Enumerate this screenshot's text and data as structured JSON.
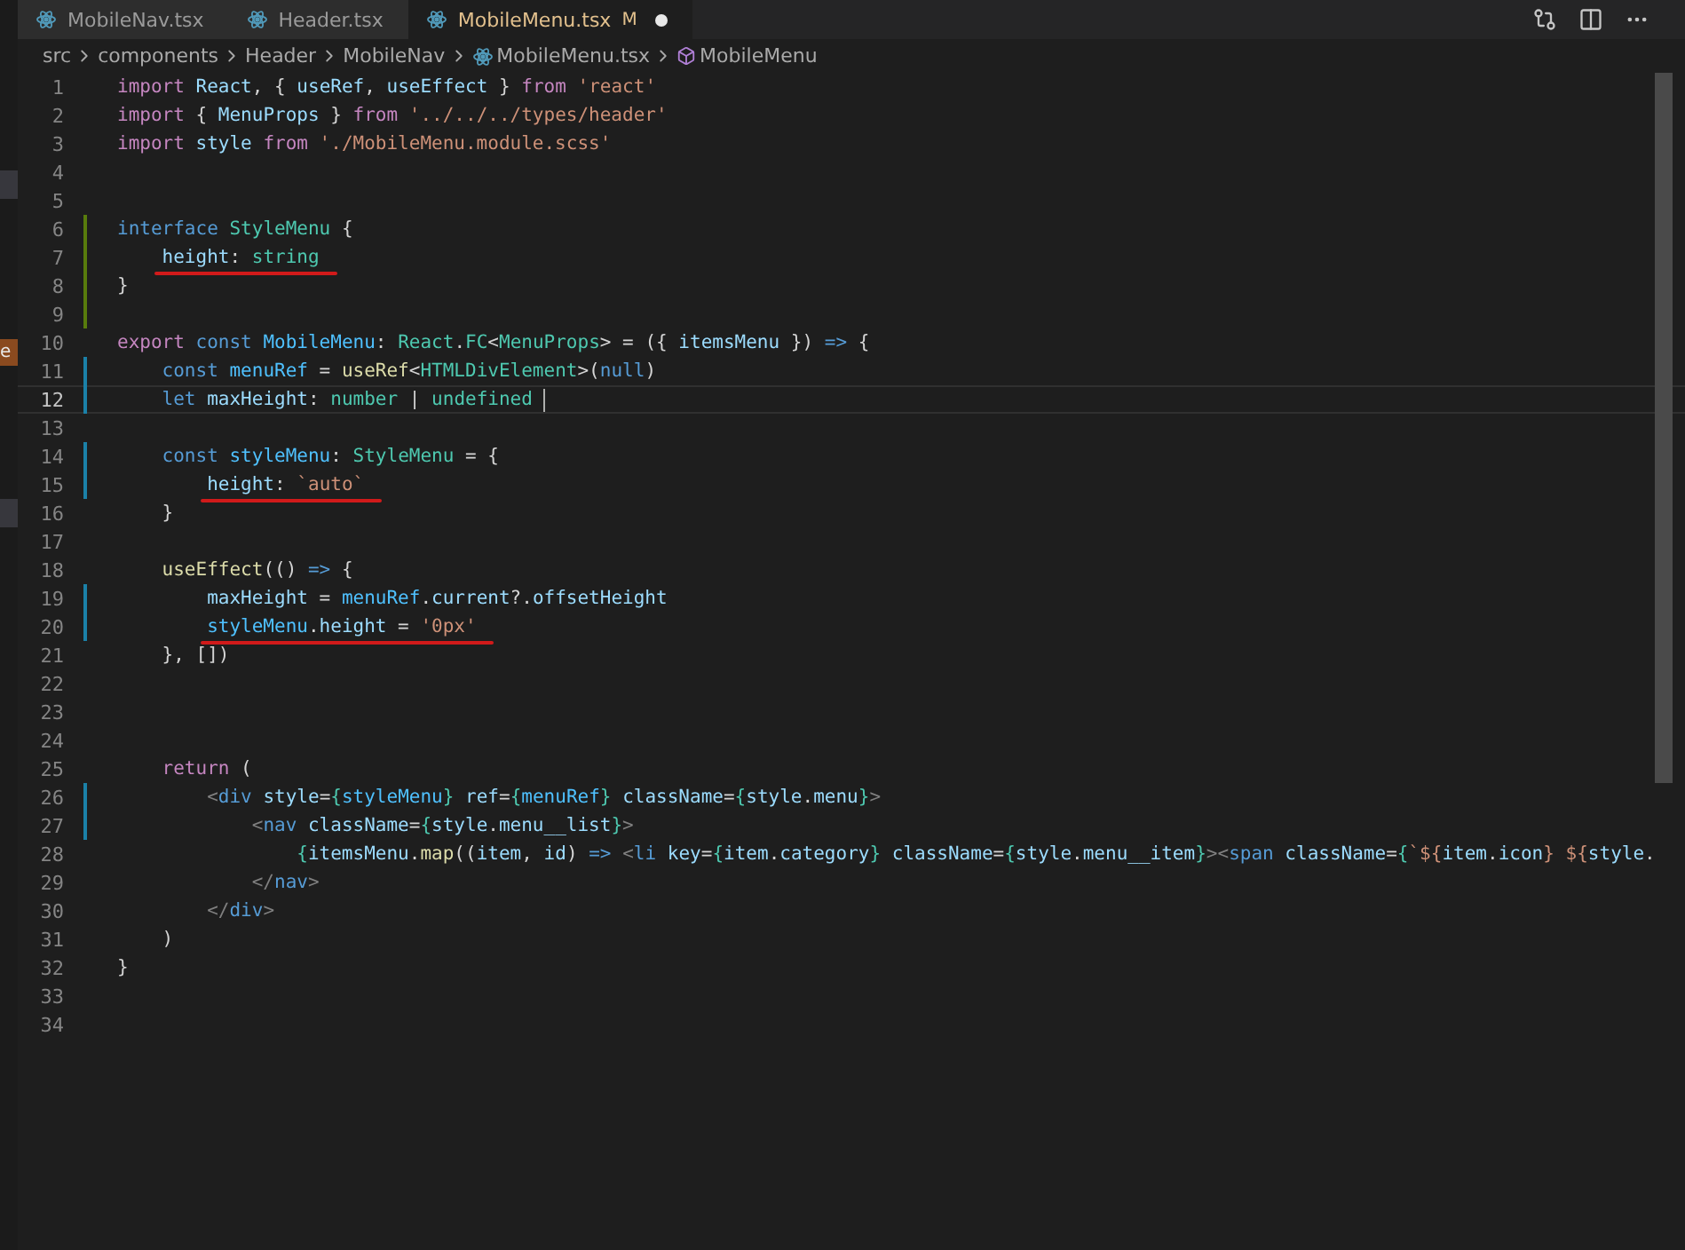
{
  "side_badge": "e",
  "tabs": [
    {
      "label": "MobileNav.tsx",
      "selected": false,
      "dirty": false
    },
    {
      "label": "Header.tsx",
      "selected": false,
      "dirty": false
    },
    {
      "label": "MobileMenu.tsx",
      "selected": true,
      "badge": "M",
      "dirty": true
    }
  ],
  "breadcrumb": [
    {
      "label": "src",
      "kind": "folder"
    },
    {
      "label": "components",
      "kind": "folder"
    },
    {
      "label": "Header",
      "kind": "folder"
    },
    {
      "label": "MobileNav",
      "kind": "folder"
    },
    {
      "label": "MobileMenu.tsx",
      "kind": "file"
    },
    {
      "label": "MobileMenu",
      "kind": "symbol"
    }
  ],
  "lines": [
    {
      "number": "1",
      "current": false,
      "underlined": false,
      "tokens": [
        {
          "kind": "kw",
          "text": "import"
        },
        {
          "kind": "v",
          "text": " React"
        },
        {
          "kind": "p",
          "text": ", { "
        },
        {
          "kind": "v",
          "text": "useRef"
        },
        {
          "kind": "p",
          "text": ", "
        },
        {
          "kind": "v",
          "text": "useEffect"
        },
        {
          "kind": "p",
          "text": " } "
        },
        {
          "kind": "kw",
          "text": "from"
        },
        {
          "kind": "s",
          "text": " 'react'"
        }
      ]
    },
    {
      "number": "2",
      "current": false,
      "underlined": false,
      "tokens": [
        {
          "kind": "kw",
          "text": "import"
        },
        {
          "kind": "p",
          "text": " { "
        },
        {
          "kind": "v",
          "text": "MenuProps"
        },
        {
          "kind": "p",
          "text": " } "
        },
        {
          "kind": "kw",
          "text": "from"
        },
        {
          "kind": "s",
          "text": " '../../../types/header'"
        }
      ]
    },
    {
      "number": "3",
      "current": false,
      "underlined": false,
      "tokens": [
        {
          "kind": "kw",
          "text": "import"
        },
        {
          "kind": "v",
          "text": " style"
        },
        {
          "kind": "kw",
          "text": " from"
        },
        {
          "kind": "s",
          "text": " './MobileMenu.module.scss'"
        }
      ]
    },
    {
      "number": "4",
      "current": false,
      "underlined": false
    },
    {
      "number": "5",
      "current": false,
      "underlined": false
    },
    {
      "number": "6",
      "current": false,
      "kind": "added",
      "underlined": false,
      "tokens": [
        {
          "kind": "st",
          "text": "interface"
        },
        {
          "kind": "t",
          "text": " StyleMenu"
        },
        {
          "kind": "p",
          "text": " {"
        }
      ]
    },
    {
      "number": "7",
      "current": false,
      "kind": "added",
      "underlined": true,
      "tokens": [
        {
          "kind": "v",
          "text": "    height"
        },
        {
          "kind": "p",
          "text": ": "
        },
        {
          "kind": "t",
          "text": "string"
        }
      ]
    },
    {
      "number": "8",
      "current": false,
      "kind": "added",
      "underlined": false,
      "tokens": [
        {
          "kind": "p",
          "text": "}"
        }
      ]
    },
    {
      "number": "9",
      "current": false,
      "kind": "added",
      "underlined": false
    },
    {
      "number": "10",
      "current": false,
      "underlined": false,
      "tokens": [
        {
          "kind": "kw",
          "text": "export"
        },
        {
          "kind": "st",
          "text": " const"
        },
        {
          "kind": "c",
          "text": " MobileMenu"
        },
        {
          "kind": "p",
          "text": ": "
        },
        {
          "kind": "t",
          "text": "React"
        },
        {
          "kind": "p",
          "text": "."
        },
        {
          "kind": "t",
          "text": "FC"
        },
        {
          "kind": "p",
          "text": "<"
        },
        {
          "kind": "t",
          "text": "MenuProps"
        },
        {
          "kind": "p",
          "text": "> = ({ "
        },
        {
          "kind": "v",
          "text": "itemsMenu"
        },
        {
          "kind": "p",
          "text": " }) "
        },
        {
          "kind": "st",
          "text": "=>"
        },
        {
          "kind": "p",
          "text": " {"
        }
      ]
    },
    {
      "number": "11",
      "current": false,
      "kind": "modified",
      "underlined": false,
      "tokens": [
        {
          "kind": "st",
          "text": "    const"
        },
        {
          "kind": "c",
          "text": " menuRef"
        },
        {
          "kind": "p",
          "text": " = "
        },
        {
          "kind": "f",
          "text": "useRef"
        },
        {
          "kind": "p",
          "text": "<"
        },
        {
          "kind": "t",
          "text": "HTMLDivElement"
        },
        {
          "kind": "p",
          "text": ">("
        },
        {
          "kind": "st",
          "text": "null"
        },
        {
          "kind": "p",
          "text": ")"
        }
      ]
    },
    {
      "number": "12",
      "current": true,
      "kind": "modified",
      "underlined": false,
      "tokens": [
        {
          "kind": "st",
          "text": "    let"
        },
        {
          "kind": "v",
          "text": " maxHeight"
        },
        {
          "kind": "p",
          "text": ": "
        },
        {
          "kind": "t",
          "text": "number"
        },
        {
          "kind": "p",
          "text": " | "
        },
        {
          "kind": "t",
          "text": "undefined "
        }
      ]
    },
    {
      "number": "13",
      "current": false,
      "underlined": false
    },
    {
      "number": "14",
      "current": false,
      "kind": "modified",
      "underlined": false,
      "tokens": [
        {
          "kind": "st",
          "text": "    const"
        },
        {
          "kind": "c",
          "text": " styleMenu"
        },
        {
          "kind": "p",
          "text": ": "
        },
        {
          "kind": "t",
          "text": "StyleMenu"
        },
        {
          "kind": "p",
          "text": " = {"
        }
      ]
    },
    {
      "number": "15",
      "current": false,
      "kind": "modified",
      "underlined": true,
      "tokens": [
        {
          "kind": "v",
          "text": "        height"
        },
        {
          "kind": "p",
          "text": ": "
        },
        {
          "kind": "s",
          "text": "`auto`"
        }
      ]
    },
    {
      "number": "16",
      "current": false,
      "underlined": false,
      "tokens": [
        {
          "kind": "p",
          "text": "    }"
        }
      ]
    },
    {
      "number": "17",
      "current": false,
      "underlined": false
    },
    {
      "number": "18",
      "current": false,
      "underlined": false,
      "tokens": [
        {
          "kind": "f",
          "text": "    useEffect"
        },
        {
          "kind": "p",
          "text": "(() "
        },
        {
          "kind": "st",
          "text": "=>"
        },
        {
          "kind": "p",
          "text": " {"
        }
      ]
    },
    {
      "number": "19",
      "current": false,
      "kind": "modified",
      "underlined": false,
      "tokens": [
        {
          "kind": "v",
          "text": "        maxHeight"
        },
        {
          "kind": "p",
          "text": " = "
        },
        {
          "kind": "c",
          "text": "menuRef"
        },
        {
          "kind": "p",
          "text": "."
        },
        {
          "kind": "v",
          "text": "current"
        },
        {
          "kind": "p",
          "text": "?."
        },
        {
          "kind": "v",
          "text": "offsetHeight"
        }
      ]
    },
    {
      "number": "20",
      "current": false,
      "kind": "modified",
      "underlined": true,
      "tokens": [
        {
          "kind": "c",
          "text": "        styleMenu"
        },
        {
          "kind": "p",
          "text": "."
        },
        {
          "kind": "v",
          "text": "height"
        },
        {
          "kind": "p",
          "text": " = "
        },
        {
          "kind": "s",
          "text": "'0px'"
        }
      ]
    },
    {
      "number": "21",
      "current": false,
      "underlined": false,
      "tokens": [
        {
          "kind": "p",
          "text": "    }, [])"
        }
      ]
    },
    {
      "number": "22",
      "current": false,
      "underlined": false
    },
    {
      "number": "23",
      "current": false,
      "underlined": false
    },
    {
      "number": "24",
      "current": false,
      "underlined": false
    },
    {
      "number": "25",
      "current": false,
      "underlined": false,
      "tokens": [
        {
          "kind": "kw",
          "text": "    return"
        },
        {
          "kind": "p",
          "text": " ("
        }
      ]
    },
    {
      "number": "26",
      "current": false,
      "kind": "modified",
      "underlined": false,
      "tokens": [
        {
          "kind": "tag",
          "text": "        <"
        },
        {
          "kind": "st",
          "text": "div"
        },
        {
          "kind": "v",
          "text": " style"
        },
        {
          "kind": "p",
          "text": "="
        },
        {
          "kind": "br",
          "text": "{"
        },
        {
          "kind": "c",
          "text": "styleMenu"
        },
        {
          "kind": "br",
          "text": "}"
        },
        {
          "kind": "v",
          "text": " ref"
        },
        {
          "kind": "p",
          "text": "="
        },
        {
          "kind": "br",
          "text": "{"
        },
        {
          "kind": "c",
          "text": "menuRef"
        },
        {
          "kind": "br",
          "text": "}"
        },
        {
          "kind": "v",
          "text": " className"
        },
        {
          "kind": "p",
          "text": "="
        },
        {
          "kind": "br",
          "text": "{"
        },
        {
          "kind": "v",
          "text": "style"
        },
        {
          "kind": "p",
          "text": "."
        },
        {
          "kind": "v",
          "text": "menu"
        },
        {
          "kind": "br",
          "text": "}"
        },
        {
          "kind": "tag",
          "text": ">"
        }
      ]
    },
    {
      "number": "27",
      "current": false,
      "kind": "modified",
      "underlined": false,
      "tokens": [
        {
          "kind": "tag",
          "text": "            <"
        },
        {
          "kind": "st",
          "text": "nav"
        },
        {
          "kind": "v",
          "text": " className"
        },
        {
          "kind": "p",
          "text": "="
        },
        {
          "kind": "br",
          "text": "{"
        },
        {
          "kind": "v",
          "text": "style"
        },
        {
          "kind": "p",
          "text": "."
        },
        {
          "kind": "v",
          "text": "menu__list"
        },
        {
          "kind": "br",
          "text": "}"
        },
        {
          "kind": "tag",
          "text": ">"
        }
      ]
    },
    {
      "number": "28",
      "current": false,
      "underlined": false,
      "tokens": [
        {
          "kind": "br",
          "text": "                {"
        },
        {
          "kind": "v",
          "text": "itemsMenu"
        },
        {
          "kind": "p",
          "text": "."
        },
        {
          "kind": "f",
          "text": "map"
        },
        {
          "kind": "p",
          "text": "(("
        },
        {
          "kind": "v",
          "text": "item"
        },
        {
          "kind": "p",
          "text": ", "
        },
        {
          "kind": "v",
          "text": "id"
        },
        {
          "kind": "p",
          "text": ") "
        },
        {
          "kind": "st",
          "text": "=>"
        },
        {
          "kind": "tag",
          "text": " <"
        },
        {
          "kind": "st",
          "text": "li"
        },
        {
          "kind": "v",
          "text": " key"
        },
        {
          "kind": "p",
          "text": "="
        },
        {
          "kind": "br",
          "text": "{"
        },
        {
          "kind": "v",
          "text": "item"
        },
        {
          "kind": "p",
          "text": "."
        },
        {
          "kind": "v",
          "text": "category"
        },
        {
          "kind": "br",
          "text": "}"
        },
        {
          "kind": "v",
          "text": " className"
        },
        {
          "kind": "p",
          "text": "="
        },
        {
          "kind": "br",
          "text": "{"
        },
        {
          "kind": "v",
          "text": "style"
        },
        {
          "kind": "p",
          "text": "."
        },
        {
          "kind": "v",
          "text": "menu__item"
        },
        {
          "kind": "br",
          "text": "}"
        },
        {
          "kind": "tag",
          "text": "><"
        },
        {
          "kind": "st",
          "text": "span"
        },
        {
          "kind": "v",
          "text": " className"
        },
        {
          "kind": "p",
          "text": "="
        },
        {
          "kind": "br",
          "text": "{"
        },
        {
          "kind": "s",
          "text": "`${"
        },
        {
          "kind": "v",
          "text": "item"
        },
        {
          "kind": "p",
          "text": "."
        },
        {
          "kind": "v",
          "text": "icon"
        },
        {
          "kind": "s",
          "text": "} ${"
        },
        {
          "kind": "v",
          "text": "style"
        },
        {
          "kind": "p",
          "text": "."
        }
      ]
    },
    {
      "number": "29",
      "current": false,
      "underlined": false,
      "tokens": [
        {
          "kind": "tag",
          "text": "            </"
        },
        {
          "kind": "st",
          "text": "nav"
        },
        {
          "kind": "tag",
          "text": ">"
        }
      ]
    },
    {
      "number": "30",
      "current": false,
      "underlined": false,
      "tokens": [
        {
          "kind": "tag",
          "text": "        </"
        },
        {
          "kind": "st",
          "text": "div"
        },
        {
          "kind": "tag",
          "text": ">"
        }
      ]
    },
    {
      "number": "31",
      "current": false,
      "underlined": false,
      "tokens": [
        {
          "kind": "p",
          "text": "    )"
        }
      ]
    },
    {
      "number": "32",
      "current": false,
      "underlined": false,
      "tokens": [
        {
          "kind": "p",
          "text": "}"
        }
      ]
    },
    {
      "number": "33",
      "current": false,
      "underlined": false
    },
    {
      "number": "34",
      "current": false,
      "underlined": false
    }
  ]
}
